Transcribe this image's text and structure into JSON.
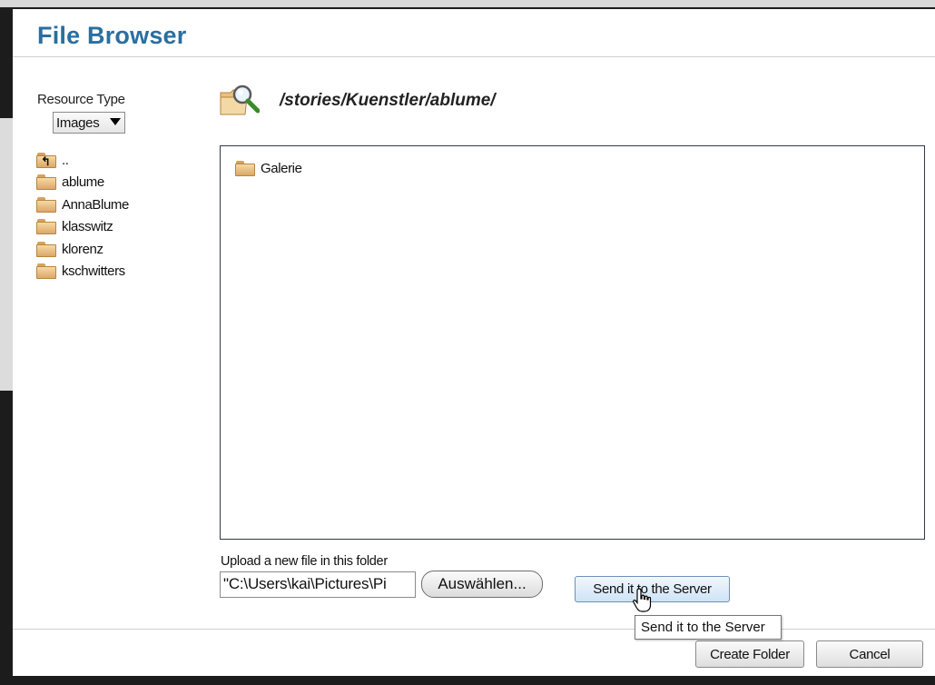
{
  "dialog": {
    "title": "File Browser",
    "resource_type_label": "Resource Type",
    "resource_type_value": "Images",
    "current_path": "/stories/Kuenstler/ablume/"
  },
  "tree": {
    "items": [
      {
        "label": "..",
        "icon": "folder-up-icon"
      },
      {
        "label": "ablume",
        "icon": "folder-icon"
      },
      {
        "label": "AnnaBlume",
        "icon": "folder-icon"
      },
      {
        "label": "klasswitz",
        "icon": "folder-icon"
      },
      {
        "label": "klorenz",
        "icon": "folder-icon"
      },
      {
        "label": "kschwitters",
        "icon": "folder-icon"
      }
    ]
  },
  "files": {
    "items": [
      {
        "label": "Galerie",
        "icon": "folder-icon"
      }
    ]
  },
  "upload": {
    "label": "Upload a new file in this folder",
    "file_value": "\"C:\\Users\\kai\\Pictures\\Pi",
    "choose_label": "Auswählen...",
    "send_label": "Send it to the Server",
    "tooltip": "Send it to the Server"
  },
  "footer": {
    "create_folder_label": "Create Folder",
    "cancel_label": "Cancel"
  },
  "colors": {
    "title": "#2a6fa0",
    "folder": "#e6b877",
    "send_button": "#cfe3f7"
  }
}
